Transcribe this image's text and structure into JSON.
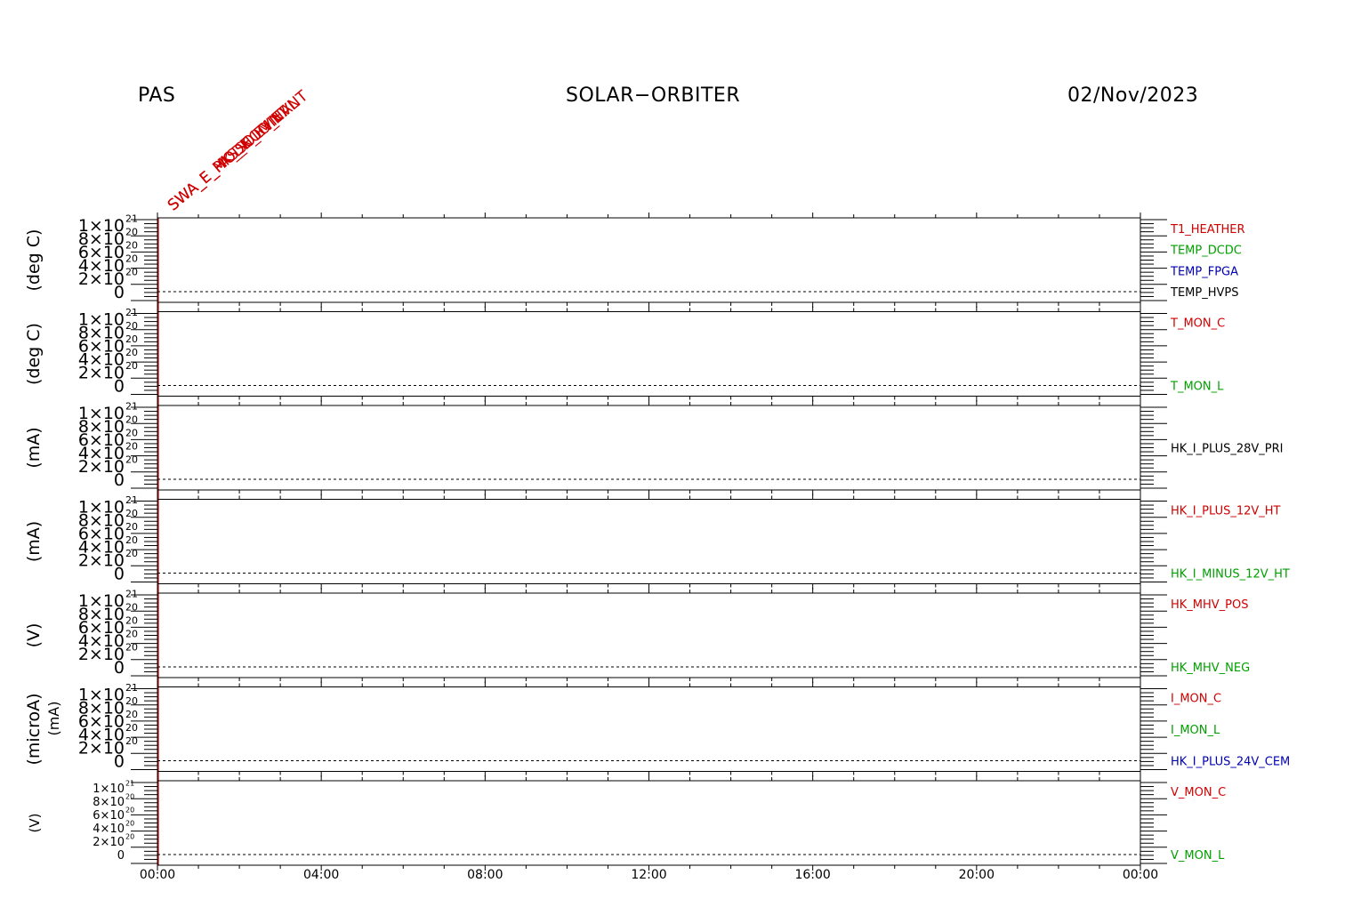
{
  "header": {
    "left": "PAS",
    "center": "SOLAR−ORBITER",
    "right": "02/Nov/2023"
  },
  "events": [
    "SWA_E_PAS_NOMINAL",
    "SWA_E_MODE_EVNT",
    "SWA_E_HK_SOLO_EVNT"
  ],
  "colors": {
    "red": "#d00000",
    "green": "#00a000",
    "blue": "#0000b0",
    "black": "#000000"
  },
  "chart_data": {
    "type": "line",
    "x_ticks": [
      "00:00",
      "04:00",
      "08:00",
      "12:00",
      "16:00",
      "20:00",
      "00:00"
    ],
    "x_range_hours": [
      0,
      24
    ],
    "y_ticks": [
      {
        "mant": "0",
        "exp": ""
      },
      {
        "mant": "2×10",
        "exp": "20"
      },
      {
        "mant": "4×10",
        "exp": "20"
      },
      {
        "mant": "6×10",
        "exp": "20"
      },
      {
        "mant": "8×10",
        "exp": "20"
      },
      {
        "mant": "1×10",
        "exp": "21"
      }
    ],
    "ylim": [
      0,
      1e+21
    ],
    "panels": [
      {
        "ylabel": "(deg C)",
        "series": [
          {
            "name": "T1_HEATHER",
            "color": "red"
          },
          {
            "name": "TEMP_DCDC",
            "color": "green"
          },
          {
            "name": "TEMP_FPGA",
            "color": "blue"
          },
          {
            "name": "TEMP_HVPS",
            "color": "black"
          }
        ]
      },
      {
        "ylabel": "(deg C)",
        "series": [
          {
            "name": "T_MON_C",
            "color": "red"
          },
          {
            "name": "T_MON_L",
            "color": "green"
          }
        ]
      },
      {
        "ylabel": "(mA)",
        "series": [
          {
            "name": "HK_I_PLUS_28V_PRI",
            "color": "black"
          }
        ]
      },
      {
        "ylabel": "(mA)",
        "series": [
          {
            "name": "HK_I_PLUS_12V_HT",
            "color": "red"
          },
          {
            "name": "HK_I_MINUS_12V_HT",
            "color": "green"
          }
        ]
      },
      {
        "ylabel": "(V)",
        "series": [
          {
            "name": "HK_MHV_POS",
            "color": "red"
          },
          {
            "name": "HK_MHV_NEG",
            "color": "green"
          }
        ]
      },
      {
        "ylabel": "(microA)",
        "ylabel2": "(mA)",
        "series": [
          {
            "name": "I_MON_C",
            "color": "red"
          },
          {
            "name": "I_MON_L",
            "color": "green"
          },
          {
            "name": "HK_I_PLUS_24V_CEM",
            "color": "blue"
          }
        ]
      },
      {
        "ylabel": "(V)",
        "series": [
          {
            "name": "V_MON_C",
            "color": "red"
          },
          {
            "name": "V_MON_L",
            "color": "green"
          }
        ]
      }
    ]
  }
}
